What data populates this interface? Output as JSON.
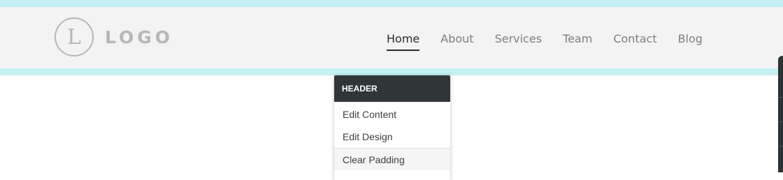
{
  "header": {
    "logo": {
      "letter": "L",
      "text": "LOGO"
    },
    "nav": [
      {
        "label": "Home",
        "active": true
      },
      {
        "label": "About"
      },
      {
        "label": "Services"
      },
      {
        "label": "Team"
      },
      {
        "label": "Contact"
      },
      {
        "label": "Blog"
      }
    ]
  },
  "context_menu": {
    "title": "HEADER",
    "items": [
      {
        "label": "Edit Content"
      },
      {
        "label": "Edit Design"
      },
      {
        "label": "Clear Padding"
      }
    ]
  },
  "colors": {
    "header_band": "#c4eff3",
    "header_bar": "#f3f3f3",
    "menu_header": "#303638",
    "active_nav": "#2b2b2b",
    "inactive_nav": "#7e7e7e"
  }
}
